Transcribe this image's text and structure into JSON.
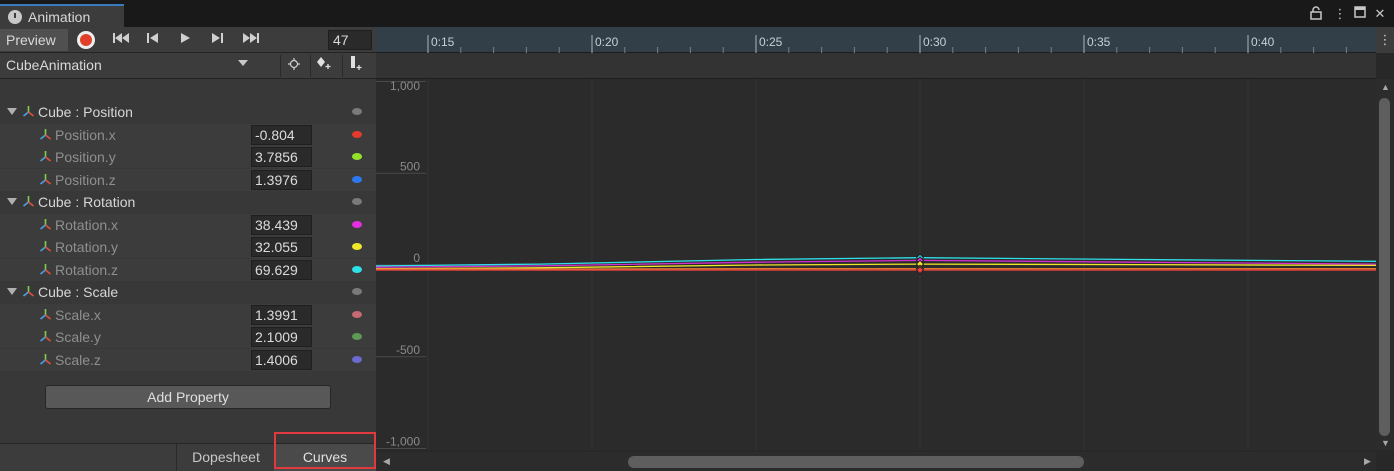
{
  "window": {
    "tab_title": "Animation"
  },
  "toolbar": {
    "preview_label": "Preview",
    "frame_value": "47"
  },
  "timeline": {
    "ticks": [
      "0:15",
      "0:20",
      "0:25",
      "0:30",
      "0:35",
      "0:40"
    ]
  },
  "clip": {
    "name": "CubeAnimation"
  },
  "properties": [
    {
      "kind": "group",
      "label": "Cube : Position",
      "color": "#7a7a7a"
    },
    {
      "kind": "prop",
      "label": "Position.x",
      "value": "-0.804",
      "color": "#e43a2e"
    },
    {
      "kind": "prop",
      "label": "Position.y",
      "value": "3.7856",
      "color": "#95e22c"
    },
    {
      "kind": "prop",
      "label": "Position.z",
      "value": "1.3976",
      "color": "#2d78f0"
    },
    {
      "kind": "group",
      "label": "Cube : Rotation",
      "color": "#7a7a7a"
    },
    {
      "kind": "prop",
      "label": "Rotation.x",
      "value": "38.439",
      "color": "#e52ee0"
    },
    {
      "kind": "prop",
      "label": "Rotation.y",
      "value": "32.055",
      "color": "#f0e62a"
    },
    {
      "kind": "prop",
      "label": "Rotation.z",
      "value": "69.629",
      "color": "#2ee0ea"
    },
    {
      "kind": "group",
      "label": "Cube : Scale",
      "color": "#7a7a7a"
    },
    {
      "kind": "prop",
      "label": "Scale.x",
      "value": "1.3991",
      "color": "#c56a74"
    },
    {
      "kind": "prop",
      "label": "Scale.y",
      "value": "2.1009",
      "color": "#5e9a56"
    },
    {
      "kind": "prop",
      "label": "Scale.z",
      "value": "1.4006",
      "color": "#6a6ad0"
    }
  ],
  "add_property_label": "Add Property",
  "bottom_tabs": {
    "dopesheet": "Dopesheet",
    "curves": "Curves"
  },
  "curve_view": {
    "y_labels": [
      "1,000",
      "500",
      "0",
      "-500",
      "-1,000"
    ],
    "curves": [
      {
        "name": "Rotation.z",
        "color": "#2ee0ea",
        "values": [
          -5,
          5,
          30,
          40,
          30,
          20
        ]
      },
      {
        "name": "Rotation.x",
        "color": "#d52ed0",
        "values": [
          -12,
          -5,
          15,
          25,
          15,
          5
        ]
      },
      {
        "name": "Rotation.y",
        "color": "#f0e62a",
        "values": [
          -20,
          -15,
          0,
          5,
          2,
          -2
        ]
      },
      {
        "name": "Position.x",
        "color": "#e07a30",
        "values": [
          -22,
          -22,
          -20,
          -20,
          -20,
          -20
        ]
      },
      {
        "name": "Position.y",
        "color": "#e44040",
        "values": [
          -28,
          -28,
          -28,
          -28,
          -28,
          -28
        ]
      }
    ]
  }
}
